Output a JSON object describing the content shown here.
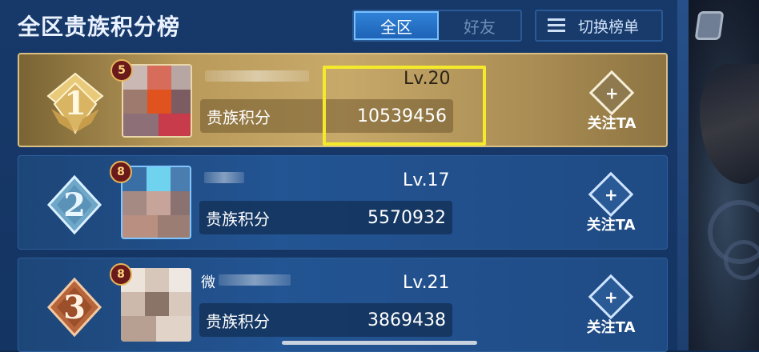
{
  "header": {
    "title": "全区贵族积分榜",
    "tabs": [
      {
        "label": "全区",
        "active": true
      },
      {
        "label": "好友",
        "active": false
      }
    ],
    "switch_button_label": "切换榜单"
  },
  "rows": [
    {
      "rank": "1",
      "noble_level": "5",
      "name_prefix": "",
      "lv": "Lv.20",
      "score_label": "贵族积分",
      "score": "10539456",
      "follow_label": "关注TA",
      "follow_icon": "+"
    },
    {
      "rank": "2",
      "noble_level": "8",
      "name_prefix": "",
      "lv": "Lv.17",
      "score_label": "贵族积分",
      "score": "5570932",
      "follow_label": "关注TA",
      "follow_icon": "+"
    },
    {
      "rank": "3",
      "noble_level": "8",
      "name_prefix": "微",
      "lv": "Lv.21",
      "score_label": "贵族积分",
      "score": "3869438",
      "follow_label": "关注TA",
      "follow_icon": "+"
    }
  ],
  "colors": {
    "highlight": "#f4ea2a",
    "gold_row": "#c7a96a",
    "blue_row": "#235493",
    "active_tab": "#2f82d8"
  }
}
